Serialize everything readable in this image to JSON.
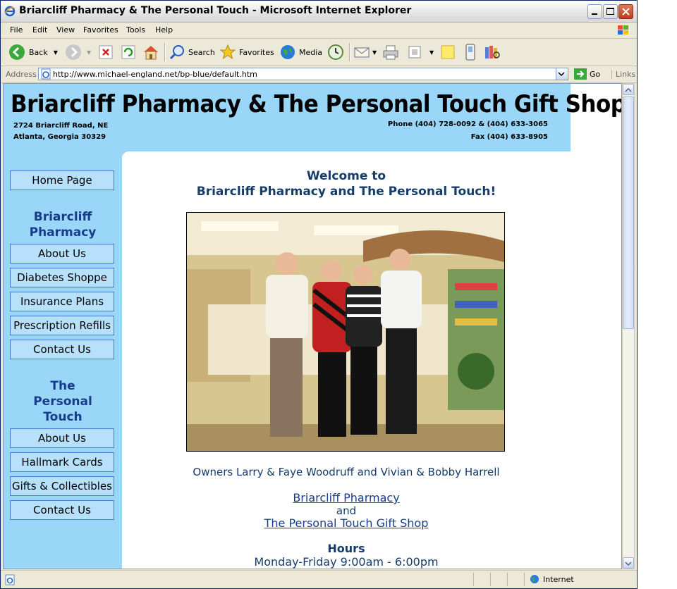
{
  "window": {
    "title": "Briarcliff Pharmacy & The Personal Touch - Microsoft Internet Explorer"
  },
  "menu": [
    "File",
    "Edit",
    "View",
    "Favorites",
    "Tools",
    "Help"
  ],
  "toolbar": {
    "back": "Back",
    "search": "Search",
    "favorites": "Favorites",
    "media": "Media"
  },
  "address": {
    "label": "Address",
    "url": "http://www.michael-england.net/bp-blue/default.htm",
    "go": "Go",
    "links": "Links"
  },
  "status": {
    "zone": "Internet"
  },
  "header": {
    "title": "Briarcliff Pharmacy & The Personal Touch Gift Shop",
    "street": "2724 Briarcliff Road, NE",
    "city": "Atlanta, Georgia 30329",
    "phone": "Phone (404) 728-0092 & (404) 633-3065",
    "fax": "Fax (404) 633-8905"
  },
  "sidebar": {
    "home": "Home Page",
    "pharmacy_heading": [
      "Briarcliff",
      "Pharmacy"
    ],
    "pharmacy_items": [
      "About Us",
      "Diabetes Shoppe",
      "Insurance Plans",
      "Prescription Refills",
      "Contact Us"
    ],
    "touch_heading": [
      "The",
      "Personal",
      "Touch"
    ],
    "touch_items": [
      "About Us",
      "Hallmark Cards",
      "Gifts & Collectibles",
      "Contact Us"
    ]
  },
  "main": {
    "welcome_line1": "Welcome to",
    "welcome_line2": "Briarcliff Pharmacy and The Personal Touch!",
    "caption": "Owners Larry & Faye Woodruff and Vivian & Bobby Harrell",
    "link_pharmacy": "Briarcliff Pharmacy",
    "and": "and",
    "link_gift": "The Personal Touch Gift Shop",
    "hours_heading": "Hours",
    "hours_weekday": "Monday-Friday 9:00am - 6:00pm"
  },
  "colors": {
    "header_bg": "#99d6f7",
    "nav_text": "#163c8a"
  }
}
